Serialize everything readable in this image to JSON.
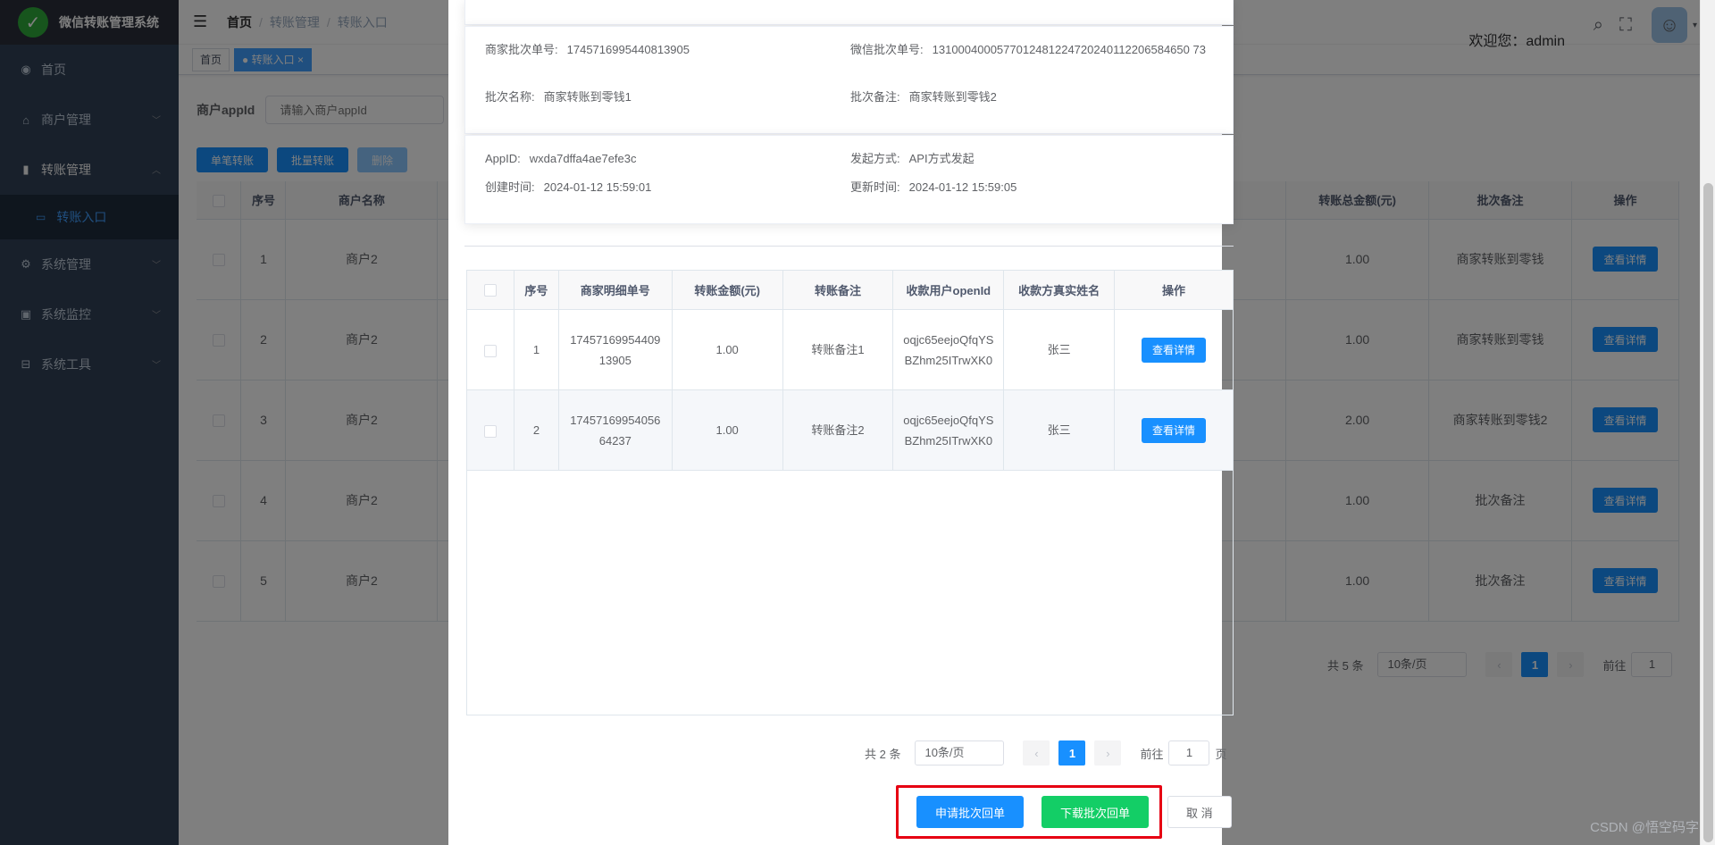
{
  "app": {
    "title": "微信转账管理系统"
  },
  "sidebar": {
    "items": [
      {
        "label": "首页",
        "icon": "dashboard-icon"
      },
      {
        "label": "商户管理",
        "icon": "shop-icon"
      },
      {
        "label": "转账管理",
        "icon": "transfer-icon"
      },
      {
        "label": "系统管理",
        "icon": "gear-icon"
      },
      {
        "label": "系统监控",
        "icon": "monitor-icon"
      },
      {
        "label": "系统工具",
        "icon": "toolbox-icon"
      }
    ],
    "sub_item": "转账入口"
  },
  "navbar": {
    "breadcrumb": [
      "首页",
      "转账管理",
      "转账入口"
    ],
    "welcome": "欢迎您：admin"
  },
  "tags": {
    "home": "首页",
    "current": "转账入口"
  },
  "search": {
    "label": "商户appId",
    "placeholder": "请输入商户appId"
  },
  "toolbar": {
    "single": "单笔转账",
    "batch": "批量转账",
    "delete": "删除"
  },
  "bg_table": {
    "headers": {
      "no": "序号",
      "merchant": "商户名称",
      "total": "转账总金额(元)",
      "remark": "批次备注",
      "op": "操作"
    },
    "rows": [
      {
        "no": "1",
        "merchant": "商户2",
        "total": "1.00",
        "remark": "商家转账到零钱",
        "op": "查看详情"
      },
      {
        "no": "2",
        "merchant": "商户2",
        "total": "1.00",
        "remark": "商家转账到零钱",
        "op": "查看详情"
      },
      {
        "no": "3",
        "merchant": "商户2",
        "total": "2.00",
        "remark": "商家转账到零钱2",
        "op": "查看详情"
      },
      {
        "no": "4",
        "merchant": "商户2",
        "total": "1.00",
        "remark": "批次备注",
        "op": "查看详情"
      },
      {
        "no": "5",
        "merchant": "商户2",
        "total": "1.00",
        "remark": "批次备注",
        "op": "查看详情"
      }
    ],
    "pager": {
      "total": "共 5 条",
      "size": "10条/页",
      "page": "1",
      "goto": "前往",
      "goto_value": "1"
    }
  },
  "dialog": {
    "info1": {
      "batch_no_label": "商家批次单号:",
      "batch_no": "1745716995440813905",
      "wx_batch_label": "微信批次单号:",
      "wx_batch": "1310004000577012481224720240112206584650 73",
      "name_label": "批次名称:",
      "name": "商家转账到零钱1",
      "remark_label": "批次备注:",
      "remark": "商家转账到零钱2"
    },
    "info2": {
      "appid_label": "AppID:",
      "appid": "wxda7dffa4ae7efe3c",
      "mode_label": "发起方式:",
      "mode": "API方式发起",
      "created_label": "创建时间:",
      "created": "2024-01-12 15:59:01",
      "updated_label": "更新时间:",
      "updated": "2024-01-12 15:59:05"
    },
    "table": {
      "headers": [
        "序号",
        "商家明细单号",
        "转账金额(元)",
        "转账备注",
        "收款用户openId",
        "收款方真实姓名",
        "操作"
      ],
      "rows": [
        {
          "no": "1",
          "detail_no": "1745716995440913905",
          "amount": "1.00",
          "remark": "转账备注1",
          "openid": "oqjc65eejoQfqYSBZhm25ITrwXK0",
          "name": "张三",
          "op": "查看详情"
        },
        {
          "no": "2",
          "detail_no": "1745716995405664237",
          "amount": "1.00",
          "remark": "转账备注2",
          "openid": "oqjc65eejoQfqYSBZhm25ITrwXK0",
          "name": "张三",
          "op": "查看详情"
        }
      ]
    },
    "pager": {
      "total": "共 2 条",
      "size": "10条/页",
      "page": "1",
      "goto": "前往",
      "goto_value": "1",
      "page_unit": "页"
    },
    "buttons": {
      "apply": "申请批次回单",
      "download": "下载批次回单",
      "cancel": "取 消"
    }
  },
  "watermark": "CSDN @悟空码字",
  "colors": {
    "primary": "#1890ff",
    "success": "#13ce66",
    "sidebar": "#304156",
    "highlight": "#e60012"
  }
}
